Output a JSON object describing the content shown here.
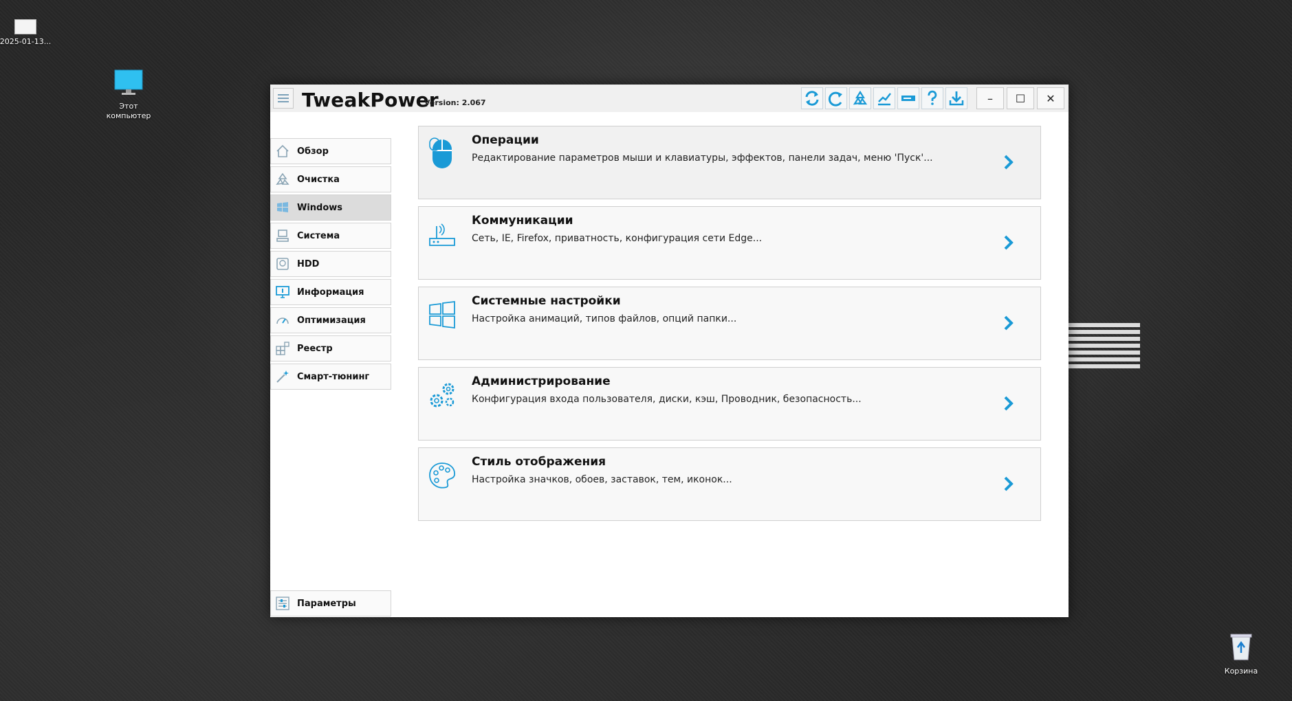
{
  "desktop": {
    "file_label": "2025-01-13...",
    "pc_label_line1": "Этот",
    "pc_label_line2": "компьютер",
    "recycle_label": "Корзина"
  },
  "window": {
    "title": "TweakPower",
    "version": "Version: 2.067",
    "accent_color": "#1a9ad6",
    "toolbar_icons": [
      "refresh-icon",
      "redo-icon",
      "recycle-icon",
      "chart-icon",
      "drive-icon",
      "help-icon",
      "download-icon"
    ],
    "controls": {
      "minimize": "–",
      "maximize": "☐",
      "close": "✕"
    }
  },
  "sidebar": {
    "items": [
      {
        "label": "Обзор",
        "icon": "home-icon",
        "active": false
      },
      {
        "label": "Очистка",
        "icon": "recycle-icon",
        "active": false
      },
      {
        "label": "Windows",
        "icon": "windows-icon",
        "active": true
      },
      {
        "label": "Система",
        "icon": "computer-icon",
        "active": false
      },
      {
        "label": "HDD",
        "icon": "disk-icon",
        "active": false
      },
      {
        "label": "Информация",
        "icon": "monitor-icon",
        "active": false
      },
      {
        "label": "Оптимизация",
        "icon": "speedometer-icon",
        "active": false
      },
      {
        "label": "Реестр",
        "icon": "registry-icon",
        "active": false
      },
      {
        "label": "Смарт-тюнинг",
        "icon": "magic-wand-icon",
        "active": false
      }
    ],
    "settings_label": "Параметры"
  },
  "cards": [
    {
      "title": "Операции",
      "desc": "Редактирование параметров мыши и клавиатуры, эффектов, панели задач, меню 'Пуск'...",
      "icon": "mouse-icon"
    },
    {
      "title": "Коммуникации",
      "desc": "Сеть, IE, Firefox, приватность, конфигурация сети Edge...",
      "icon": "router-icon"
    },
    {
      "title": "Системные настройки",
      "desc": "Настройка анимаций, типов файлов, опций папки...",
      "icon": "windows-logo-icon"
    },
    {
      "title": "Администрирование",
      "desc": "Конфигурация входа пользователя, диски, кэш, Проводник, безопасность...",
      "icon": "gears-icon"
    },
    {
      "title": "Стиль отображения",
      "desc": "Настройка значков, обоев, заставок, тем, иконок...",
      "icon": "palette-icon"
    }
  ]
}
